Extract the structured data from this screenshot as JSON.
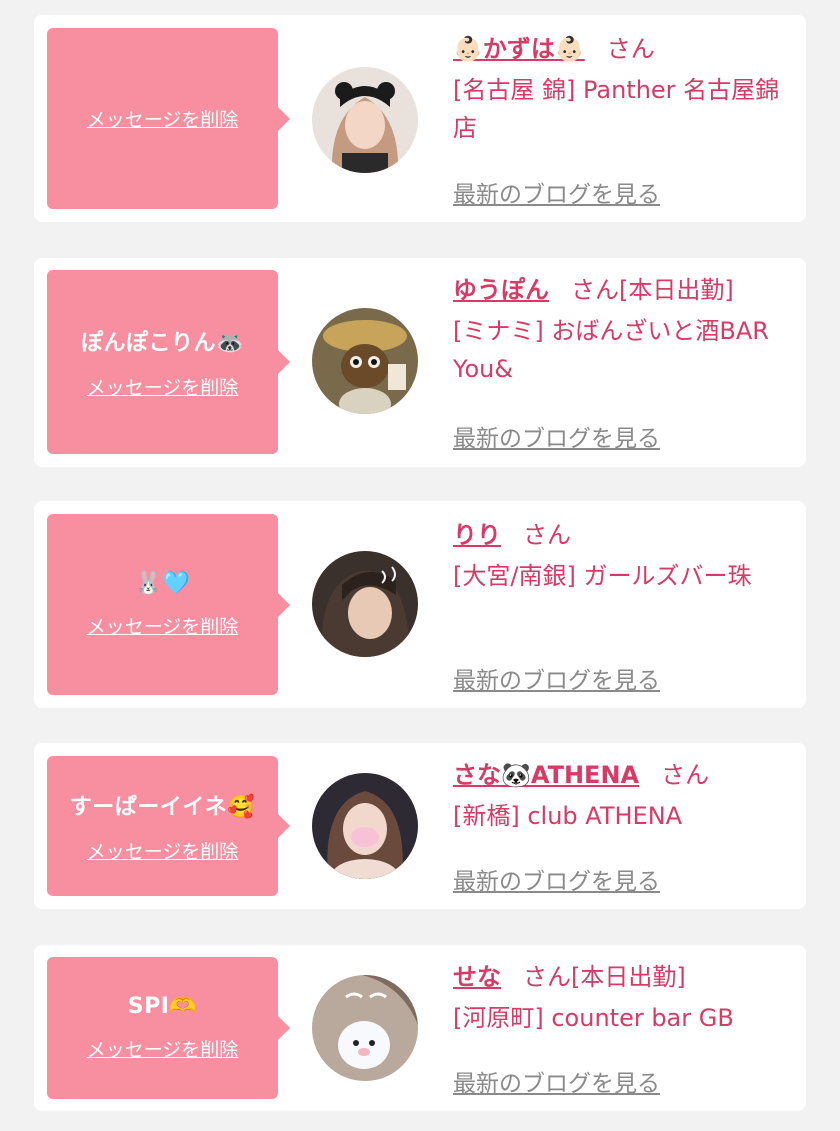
{
  "colors": {
    "accent": "#d83a66",
    "bubble": "#f78fa0",
    "background": "#f2f2f2",
    "card": "#ffffff",
    "blog_link": "#8a8a8a"
  },
  "common": {
    "delete_label": "メッセージを削除",
    "blog_label": "最新のブログを見る",
    "honorific": "さん"
  },
  "favorites": [
    {
      "message": "",
      "name": "👶🏻かずは👶🏻",
      "status": "",
      "store": "[名古屋 錦] Panther 名古屋錦店",
      "avatar_icon": "cat-ears-girl-photo"
    },
    {
      "message": "ぽんぽこりん🦝",
      "name": "ゆうぽん",
      "status": "[本日出勤]",
      "store": "[ミナミ] おばんざいと酒BAR You&",
      "avatar_icon": "tanuki-statue-photo"
    },
    {
      "message": "🐰🩵",
      "name": "りり",
      "status": "",
      "store": "[大宮/南銀] ガールズバー珠",
      "avatar_icon": "girl-selfie-photo"
    },
    {
      "message": "すーぱーイイネ🥰",
      "name": "さな🐼ATHENA",
      "status": "",
      "store": "[新橋] club ATHENA",
      "avatar_icon": "masked-girl-photo"
    },
    {
      "message": "SPI🫶",
      "name": "せな",
      "status": "[本日出勤]",
      "store": "[河原町] counter bar GB",
      "avatar_icon": "fluffy-sticker-photo"
    }
  ]
}
